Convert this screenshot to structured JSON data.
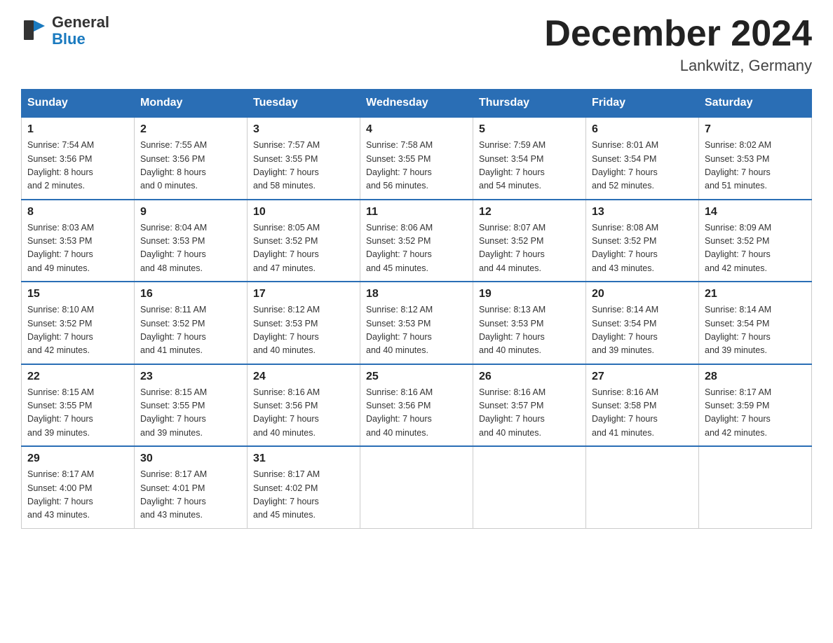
{
  "header": {
    "logo_general": "General",
    "logo_blue": "Blue",
    "month_title": "December 2024",
    "location": "Lankwitz, Germany"
  },
  "days_of_week": [
    "Sunday",
    "Monday",
    "Tuesday",
    "Wednesday",
    "Thursday",
    "Friday",
    "Saturday"
  ],
  "weeks": [
    [
      {
        "day": "1",
        "sunrise": "7:54 AM",
        "sunset": "3:56 PM",
        "daylight": "8 hours and 2 minutes."
      },
      {
        "day": "2",
        "sunrise": "7:55 AM",
        "sunset": "3:56 PM",
        "daylight": "8 hours and 0 minutes."
      },
      {
        "day": "3",
        "sunrise": "7:57 AM",
        "sunset": "3:55 PM",
        "daylight": "7 hours and 58 minutes."
      },
      {
        "day": "4",
        "sunrise": "7:58 AM",
        "sunset": "3:55 PM",
        "daylight": "7 hours and 56 minutes."
      },
      {
        "day": "5",
        "sunrise": "7:59 AM",
        "sunset": "3:54 PM",
        "daylight": "7 hours and 54 minutes."
      },
      {
        "day": "6",
        "sunrise": "8:01 AM",
        "sunset": "3:54 PM",
        "daylight": "7 hours and 52 minutes."
      },
      {
        "day": "7",
        "sunrise": "8:02 AM",
        "sunset": "3:53 PM",
        "daylight": "7 hours and 51 minutes."
      }
    ],
    [
      {
        "day": "8",
        "sunrise": "8:03 AM",
        "sunset": "3:53 PM",
        "daylight": "7 hours and 49 minutes."
      },
      {
        "day": "9",
        "sunrise": "8:04 AM",
        "sunset": "3:53 PM",
        "daylight": "7 hours and 48 minutes."
      },
      {
        "day": "10",
        "sunrise": "8:05 AM",
        "sunset": "3:52 PM",
        "daylight": "7 hours and 47 minutes."
      },
      {
        "day": "11",
        "sunrise": "8:06 AM",
        "sunset": "3:52 PM",
        "daylight": "7 hours and 45 minutes."
      },
      {
        "day": "12",
        "sunrise": "8:07 AM",
        "sunset": "3:52 PM",
        "daylight": "7 hours and 44 minutes."
      },
      {
        "day": "13",
        "sunrise": "8:08 AM",
        "sunset": "3:52 PM",
        "daylight": "7 hours and 43 minutes."
      },
      {
        "day": "14",
        "sunrise": "8:09 AM",
        "sunset": "3:52 PM",
        "daylight": "7 hours and 42 minutes."
      }
    ],
    [
      {
        "day": "15",
        "sunrise": "8:10 AM",
        "sunset": "3:52 PM",
        "daylight": "7 hours and 42 minutes."
      },
      {
        "day": "16",
        "sunrise": "8:11 AM",
        "sunset": "3:52 PM",
        "daylight": "7 hours and 41 minutes."
      },
      {
        "day": "17",
        "sunrise": "8:12 AM",
        "sunset": "3:53 PM",
        "daylight": "7 hours and 40 minutes."
      },
      {
        "day": "18",
        "sunrise": "8:12 AM",
        "sunset": "3:53 PM",
        "daylight": "7 hours and 40 minutes."
      },
      {
        "day": "19",
        "sunrise": "8:13 AM",
        "sunset": "3:53 PM",
        "daylight": "7 hours and 40 minutes."
      },
      {
        "day": "20",
        "sunrise": "8:14 AM",
        "sunset": "3:54 PM",
        "daylight": "7 hours and 39 minutes."
      },
      {
        "day": "21",
        "sunrise": "8:14 AM",
        "sunset": "3:54 PM",
        "daylight": "7 hours and 39 minutes."
      }
    ],
    [
      {
        "day": "22",
        "sunrise": "8:15 AM",
        "sunset": "3:55 PM",
        "daylight": "7 hours and 39 minutes."
      },
      {
        "day": "23",
        "sunrise": "8:15 AM",
        "sunset": "3:55 PM",
        "daylight": "7 hours and 39 minutes."
      },
      {
        "day": "24",
        "sunrise": "8:16 AM",
        "sunset": "3:56 PM",
        "daylight": "7 hours and 40 minutes."
      },
      {
        "day": "25",
        "sunrise": "8:16 AM",
        "sunset": "3:56 PM",
        "daylight": "7 hours and 40 minutes."
      },
      {
        "day": "26",
        "sunrise": "8:16 AM",
        "sunset": "3:57 PM",
        "daylight": "7 hours and 40 minutes."
      },
      {
        "day": "27",
        "sunrise": "8:16 AM",
        "sunset": "3:58 PM",
        "daylight": "7 hours and 41 minutes."
      },
      {
        "day": "28",
        "sunrise": "8:17 AM",
        "sunset": "3:59 PM",
        "daylight": "7 hours and 42 minutes."
      }
    ],
    [
      {
        "day": "29",
        "sunrise": "8:17 AM",
        "sunset": "4:00 PM",
        "daylight": "7 hours and 43 minutes."
      },
      {
        "day": "30",
        "sunrise": "8:17 AM",
        "sunset": "4:01 PM",
        "daylight": "7 hours and 43 minutes."
      },
      {
        "day": "31",
        "sunrise": "8:17 AM",
        "sunset": "4:02 PM",
        "daylight": "7 hours and 45 minutes."
      },
      null,
      null,
      null,
      null
    ]
  ],
  "labels": {
    "sunrise": "Sunrise:",
    "sunset": "Sunset:",
    "daylight": "Daylight:"
  }
}
